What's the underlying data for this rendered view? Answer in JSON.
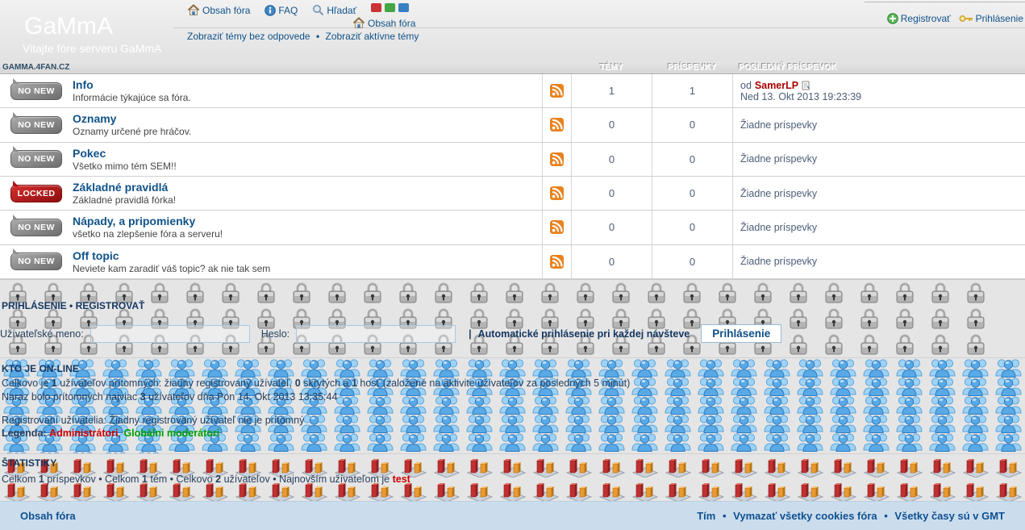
{
  "header": {
    "title": "GaMmA",
    "subtitle": "Vitajte fóre serveru GaMmA",
    "site_host": "GAMMA.4FAN.CZ",
    "nav_board_index": "Obsah fóra",
    "nav_faq": "FAQ",
    "nav_search": "Hľadať",
    "nav_board_index2": "Obsah fóra",
    "nav_unanswered": "Zobraziť témy bez odpovede",
    "nav_sep": "•",
    "nav_active": "Zobraziť aktívne témy",
    "nav_register": "Registrovať",
    "nav_login": "Prihlásenie"
  },
  "table": {
    "col_topics": "TÉMY",
    "col_posts": "PRÍSPEVKY",
    "col_last": "POSLEDNÝ PRÍSPEVOK",
    "rows": [
      {
        "badge": "NO NEW",
        "title": "Info",
        "desc": "Informácie týkajúce sa fóra.",
        "topics": "1",
        "posts": "1",
        "last_prefix": "od",
        "last_user": "SamerLP",
        "last_time": "Ned 13. Okt 2013 19:23:39"
      },
      {
        "badge": "NO NEW",
        "title": "Oznamy",
        "desc": "Oznamy určené pre hráčov.",
        "topics": "0",
        "posts": "0",
        "last_none": "Žiadne príspevky"
      },
      {
        "badge": "NO NEW",
        "title": "Pokec",
        "desc": "Všetko mimo tém SEM!!",
        "topics": "0",
        "posts": "0",
        "last_none": "Žiadne príspevky"
      },
      {
        "badge": "LOCKED",
        "title": "Základné pravidlá",
        "desc": "Základné pravidlá fórka!",
        "topics": "0",
        "posts": "0",
        "last_none": "Žiadne príspevky"
      },
      {
        "badge": "NO NEW",
        "title": "Nápady, a pripomienky",
        "desc": "všetko na zlepšenie fóra a serveru!",
        "topics": "0",
        "posts": "0",
        "last_none": "Žiadne príspevky"
      },
      {
        "badge": "NO NEW",
        "title": "Off topic",
        "desc": "Neviete kam zaradiť váš topic? ak nie tak sem",
        "topics": "0",
        "posts": "0",
        "last_none": "Žiadne príspevky"
      }
    ]
  },
  "login": {
    "link_login": "PRIHLÁSENIE",
    "sep": "•",
    "link_register": "REGISTROVAŤ",
    "username_label": "Užívateľské meno:",
    "password_label": "Heslo:",
    "pipe": "|",
    "autologin_label": "Automatické prihlásenie pri každej návšteve",
    "submit_label": "Prihlásenie"
  },
  "online": {
    "header": "KTO JE ON-LINE",
    "l1_t1": "Celkovo je",
    "l1_n1": "1",
    "l1_t2": "užívateľov prítomných: žiadny registrovaný užívateľ,",
    "l1_n2": "0",
    "l1_t3": "skrytých a",
    "l1_n3": "1",
    "l1_t4": "hosť (založené na aktivite užívateľov za posledných 5 minút)",
    "l2_t1": "Naraz bolo prítomných najviac",
    "l2_n1": "3",
    "l2_t2": "užívateľov dňa Pon 14. Okt 2013 13:35:44",
    "l3": "Registrovaní užívatelia: Žiadny registrovaný užívateľ nie je prítomný",
    "legend_label": "Legenda:",
    "legend_admin": "Administrátori",
    "legend_sep": ",",
    "legend_mod": "Globálni moderátori"
  },
  "stats": {
    "header": "ŠTATISTIKY",
    "t1": "Celkom",
    "n1": "1",
    "t2": "príspevkov • Celkom",
    "n2": "1",
    "t3": "tém • Celkovo",
    "n3": "2",
    "t4": "užívateľov • Najnovším užívateľom je",
    "newest_user": "test"
  },
  "footer": {
    "board_index": "Obsah fóra",
    "team": "Tím",
    "sep1": "•",
    "cookies": "Vymazať všetky cookies fóra",
    "sep2": "•",
    "times": "Všetky časy sú v GMT"
  },
  "colors": {
    "link": "#105289",
    "username": "#a90000",
    "admin": "#cc0000",
    "moderator": "#00a000",
    "newest_user": "#cc0000",
    "badge_locked": "#b01212",
    "rss": "#e8821e",
    "footer_bg": "#cbdded",
    "section_bg": "#e5e5e5"
  }
}
